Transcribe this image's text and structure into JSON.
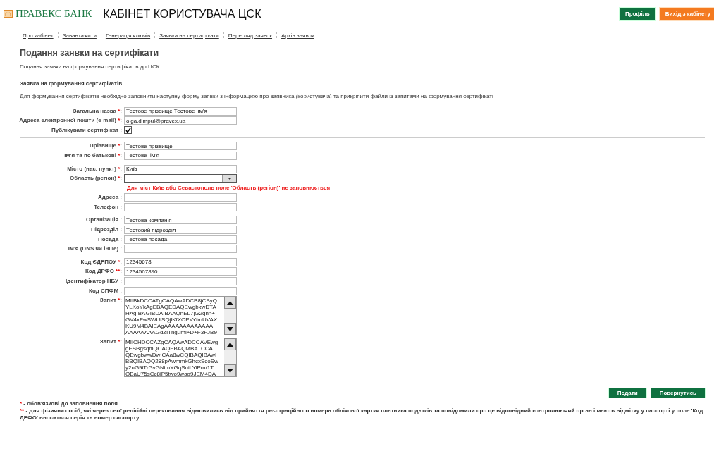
{
  "header": {
    "bank_name": "ПРАВЕКС БАНК",
    "title": "КАБІНЕТ КОРИСТУВАЧА ЦСК",
    "buttons": [
      {
        "label": "Профіль",
        "kind": "primary"
      },
      {
        "label": "Вихід з кабінету",
        "kind": "exit"
      }
    ]
  },
  "nav": [
    {
      "label": "Про кабінет"
    },
    {
      "label": "Завантажити"
    },
    {
      "label": "Генерація ключів"
    },
    {
      "label": "Заявка на сертифікати"
    },
    {
      "label": "Перегляд заявок"
    },
    {
      "label": "Архів заявок"
    }
  ],
  "page": {
    "title": "Подання заявки на сертифікати",
    "subtitle": "Подання заявки на формування сертифікатів до ЦСК",
    "section_title": "Заявка на формування сертифікатів",
    "description": "Для формування сертифікатів необхідно заповнити наступну форму заявки з інформацією про заявника (користувача) та прикріпити файли із запитами на формування сертифікаті"
  },
  "fields": [
    {
      "kind": "text",
      "label": "Загальна назва",
      "required": "*",
      "colon": ":",
      "value": "Тестове прізвище Тестове  ім'я"
    },
    {
      "kind": "text",
      "label": "Адреса електронної пошти (e-mail)",
      "required": "*",
      "colon": ":",
      "value": "olga.dimpul@pravex.ua"
    },
    {
      "kind": "checkbox",
      "label": "Публікувати сертифікат",
      "colon": ":",
      "checked": true
    },
    {
      "kind": "divider"
    },
    {
      "kind": "text",
      "label": "Прізвище",
      "required": "*",
      "colon": ":",
      "value": "Тестове прізвище"
    },
    {
      "kind": "text",
      "label": "Ім'я та по батькові",
      "required": "*",
      "colon": ":",
      "value": "Тестове  ім'я"
    },
    {
      "kind": "gap"
    },
    {
      "kind": "text",
      "label": "Місто (нас. пункт)",
      "required": "*",
      "colon": ":",
      "value": "Київ"
    },
    {
      "kind": "select",
      "label": "Область (регіон)",
      "required": "*",
      "colon": ":"
    },
    {
      "kind": "note",
      "text": "Для міст Київ або Севастополь поле 'Область (регіон)' не заповнюється"
    },
    {
      "kind": "text",
      "label": "Адреса",
      "colon": ":"
    },
    {
      "kind": "text",
      "label": "Телефон",
      "colon": ":"
    },
    {
      "kind": "gap"
    },
    {
      "kind": "text",
      "label": "Організація",
      "colon": ":",
      "value": "Тестова компанія"
    },
    {
      "kind": "text",
      "label": "Підрозділ",
      "colon": ":",
      "value": "Тестовий підрозділ"
    },
    {
      "kind": "text",
      "label": "Посада",
      "colon": ":",
      "value": "Тестова посада"
    },
    {
      "kind": "text",
      "label": "Ім'я (DNS чи інше)",
      "colon": ":"
    },
    {
      "kind": "gap"
    },
    {
      "kind": "text",
      "label": "Код ЄДРПОУ",
      "required": "*",
      "colon": ":",
      "value": "12345678"
    },
    {
      "kind": "text",
      "label": "Код ДРФО",
      "required": "**",
      "colon": ":",
      "value": "1234567890"
    },
    {
      "kind": "text",
      "label": "Ідентифікатор НБУ",
      "colon": ":"
    },
    {
      "kind": "text",
      "label": "Код СПФМ",
      "colon": ":"
    },
    {
      "kind": "textarea",
      "label": "Запит",
      "required": "*",
      "colon": ":",
      "lines": [
        "MIIBkDCCATgCAQAwADCB8jCByQ",
        "YLKoYkAgEBAQEDAQEwgbkwDTA",
        "HAgIBAGIBDAIBAAQhEL7jG2qnh+",
        "GV4xFwSWUiSQjlKfXOPkYfmUVAX",
        "KU9M4BAIEAgAAAAAAAAAAAAA",
        "AAAAAAAAGdZiTnguml+D+F3FJB9"
      ]
    },
    {
      "kind": "textarea",
      "label": "Запит",
      "required": "*",
      "colon": ":",
      "lines": [
        "MIICHDCCAZgCAQAwADCCAVEwg",
        "gESBgsqhiQCAQEBAQMBATCCA",
        "QEwgbwwDwICAa8wCQIBAQIBAwI",
        "BBQIBAQQ288pAwmmkGhcxScoSw",
        "y2uG9iTrGvGNimXGqSuiLYiPm/1T",
        "QBaU75sCc8jP5two9wag9JEM4DA"
      ]
    }
  ],
  "actions": [
    {
      "label": "Подати"
    },
    {
      "label": "Повернутись"
    }
  ],
  "footnotes": [
    {
      "mark": "*",
      "text": " - обов'язкові до заповнення поля"
    },
    {
      "mark": "**",
      "text": " - для фізичних осіб, які через свої релігійні переконання відмовились від прийняття реєстраційного номера облікової картки платника податків та повідомили про це відповідний контролюючий орган і мають відмітку у паспорті у поле 'Код ДРФО' вноситься серія та номер паспорту."
    }
  ]
}
